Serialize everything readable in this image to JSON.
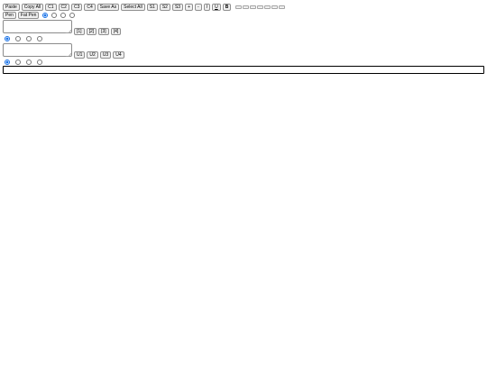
{
  "toolbar1": {
    "buttons": [
      "Paste",
      "Copy All",
      "C1",
      "C2",
      "C3",
      "C4",
      "Save As",
      "Select All",
      "S1",
      "S2",
      "S3",
      "+",
      "-",
      "I",
      "U",
      "B"
    ],
    "swatch_count": 7
  },
  "toolbar2": {
    "buttons": [
      "Pen",
      "Fat Pen"
    ],
    "radio_selected": 0
  },
  "editor1": {
    "value": "",
    "buttons": [
      "[1]",
      "[2]",
      "[3]",
      "[4]"
    ],
    "radio_selected": 0
  },
  "editor2": {
    "value": "",
    "buttons": [
      "U1",
      "U2",
      "U3",
      "U4"
    ],
    "radio_selected": 0
  },
  "output_bar": {
    "value": ""
  }
}
